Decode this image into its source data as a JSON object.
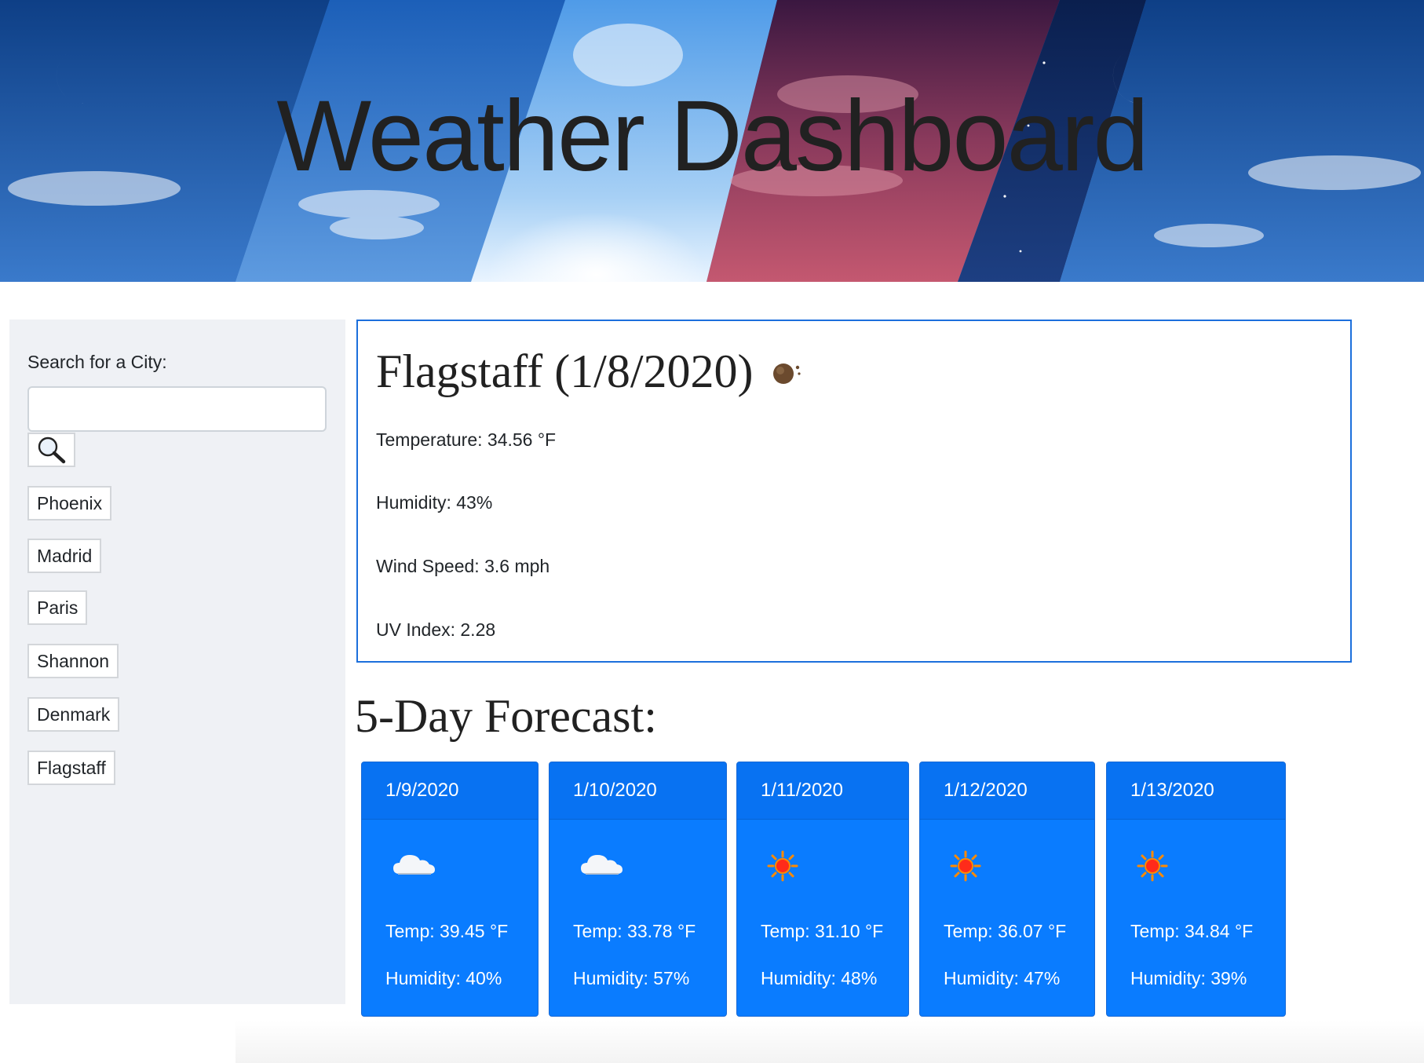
{
  "header": {
    "title": "Weather Dashboard"
  },
  "sidebar": {
    "search_label": "Search for a City:",
    "search_value": "",
    "search_placeholder": "",
    "search_button_icon": "search-icon",
    "cities": [
      "Phoenix",
      "Madrid",
      "Paris",
      "Shannon",
      "Denmark",
      "Flagstaff"
    ]
  },
  "current": {
    "title": "Flagstaff (1/8/2020)",
    "icon": "mixed-weather-icon",
    "temperature": "Temperature: 34.56 °F",
    "humidity": "Humidity: 43%",
    "wind": "Wind Speed: 3.6 mph",
    "uv": "UV Index: 2.28"
  },
  "forecast": {
    "heading": "5-Day Forecast:",
    "days": [
      {
        "date": "1/9/2020",
        "icon": "cloud-icon",
        "temp": "Temp: 39.45 °F",
        "humidity": "Humidity: 40%"
      },
      {
        "date": "1/10/2020",
        "icon": "cloud-icon",
        "temp": "Temp: 33.78 °F",
        "humidity": "Humidity: 57%"
      },
      {
        "date": "1/11/2020",
        "icon": "sun-icon",
        "temp": "Temp: 31.10 °F",
        "humidity": "Humidity: 48%"
      },
      {
        "date": "1/12/2020",
        "icon": "sun-icon",
        "temp": "Temp: 36.07 °F",
        "humidity": "Humidity: 47%"
      },
      {
        "date": "1/13/2020",
        "icon": "sun-icon",
        "temp": "Temp: 34.84 °F",
        "humidity": "Humidity: 39%"
      }
    ]
  },
  "colors": {
    "card_blue": "#0a7cff",
    "current_border": "#1c6fdc",
    "sidebar_bg": "#eff1f5"
  }
}
